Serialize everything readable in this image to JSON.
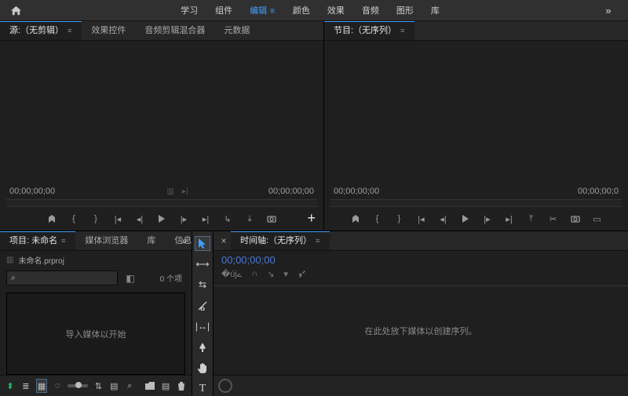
{
  "workspaces": {
    "items": [
      {
        "label": "学习"
      },
      {
        "label": "组件"
      },
      {
        "label": "编辑",
        "active": true
      },
      {
        "label": "颜色"
      },
      {
        "label": "效果"
      },
      {
        "label": "音频"
      },
      {
        "label": "图形"
      },
      {
        "label": "库"
      }
    ],
    "more": "»"
  },
  "source_panel": {
    "tabs": [
      {
        "label": "源:（无剪辑）",
        "active": true
      },
      {
        "label": "效果控件"
      },
      {
        "label": "音频剪辑混合器"
      },
      {
        "label": "元数据"
      }
    ],
    "tc_left": "00;00;00;00",
    "tc_right": "00;00;00;00",
    "add": "+"
  },
  "program_panel": {
    "tabs": [
      {
        "label": "节目:（无序列）",
        "active": true
      }
    ],
    "tc_left": "00;00;00;00",
    "tc_right": "00;00;00;0"
  },
  "project_panel": {
    "tabs": [
      {
        "label": "项目: 未命名",
        "active": true
      },
      {
        "label": "媒体浏览器"
      },
      {
        "label": "库"
      },
      {
        "label": "信息"
      }
    ],
    "more": "»",
    "file_name": "未命名.prproj",
    "search_placeholder": "",
    "count": "0 个项",
    "drop_hint": "导入媒体以开始"
  },
  "timeline_panel": {
    "close": "×",
    "tab": "时间轴:（无序列）",
    "tc": "00;00;00;00",
    "drop_hint": "在此处放下媒体以创建序列。"
  },
  "icons": {
    "search": "⌕"
  }
}
